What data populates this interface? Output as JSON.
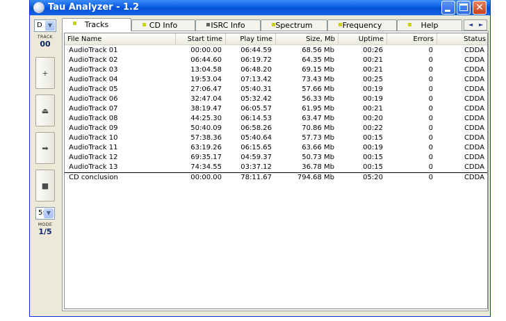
{
  "window": {
    "title": "Tau Analyzer - 1.2",
    "close_glyph": "✕"
  },
  "left_panel": {
    "drive_value": "D",
    "track_label": "TRACK",
    "track_number": "00",
    "buttons": [
      {
        "name": "add-button",
        "glyph": "+",
        "icon": "plus-icon"
      },
      {
        "name": "eject-button",
        "glyph": "⏏",
        "icon": "eject-icon"
      },
      {
        "name": "play-button",
        "glyph": "➡",
        "icon": "play-icon"
      },
      {
        "name": "stop-button",
        "glyph": "■",
        "icon": "stop-icon"
      }
    ],
    "speed_value": "5:",
    "mode_label": "MODE",
    "mode_value": "1/5"
  },
  "tabs": [
    {
      "label": "Tracks",
      "active": true,
      "led_color": "#c8d400"
    },
    {
      "label": "CD Info",
      "active": false,
      "led_color": "#c8d400"
    },
    {
      "label": "ISRC Info",
      "active": false,
      "led_color": "#606060"
    },
    {
      "label": "Spectrum",
      "active": false,
      "led_color": "#c8d400"
    },
    {
      "label": "Frequency",
      "active": false,
      "led_color": "#c8d400"
    },
    {
      "label": "Help",
      "active": false,
      "led_color": "#c8d400"
    }
  ],
  "tab_scroll": {
    "left": "◄",
    "right": "►"
  },
  "table": {
    "columns": [
      "File Name",
      "Start time",
      "Play time",
      "Size, Mb",
      "Uptime",
      "Errors",
      "Status"
    ],
    "rows": [
      [
        "AudioTrack 01",
        "00:00.00",
        "06:44.59",
        "68.56 Mb",
        "00:26",
        "0",
        "CDDA"
      ],
      [
        "AudioTrack 02",
        "06:44.60",
        "06:19.72",
        "64.35 Mb",
        "00:21",
        "0",
        "CDDA"
      ],
      [
        "AudioTrack 03",
        "13:04.58",
        "06:48.20",
        "69.15 Mb",
        "00:21",
        "0",
        "CDDA"
      ],
      [
        "AudioTrack 04",
        "19:53.04",
        "07:13.42",
        "73.43 Mb",
        "00:25",
        "0",
        "CDDA"
      ],
      [
        "AudioTrack 05",
        "27:06.47",
        "05:40.31",
        "57.66 Mb",
        "00:19",
        "0",
        "CDDA"
      ],
      [
        "AudioTrack 06",
        "32:47.04",
        "05:32.42",
        "56.33 Mb",
        "00:19",
        "0",
        "CDDA"
      ],
      [
        "AudioTrack 07",
        "38:19.47",
        "06:05.57",
        "61.95 Mb",
        "00:21",
        "0",
        "CDDA"
      ],
      [
        "AudioTrack 08",
        "44:25.30",
        "06:14.53",
        "63.47 Mb",
        "00:20",
        "0",
        "CDDA"
      ],
      [
        "AudioTrack 09",
        "50:40.09",
        "06:58.26",
        "70.86 Mb",
        "00:22",
        "0",
        "CDDA"
      ],
      [
        "AudioTrack 10",
        "57:38.36",
        "05:40.64",
        "57.73 Mb",
        "00:15",
        "0",
        "CDDA"
      ],
      [
        "AudioTrack 11",
        "63:19.26",
        "06:15.65",
        "63.66 Mb",
        "00:19",
        "0",
        "CDDA"
      ],
      [
        "AudioTrack 12",
        "69:35.17",
        "04:59.37",
        "50.73 Mb",
        "00:15",
        "0",
        "CDDA"
      ],
      [
        "AudioTrack 13",
        "74:34.55",
        "03:37.12",
        "36.78 Mb",
        "00:15",
        "0",
        "CDDA"
      ]
    ],
    "summary": [
      "CD conclusion",
      "00:00.00",
      "78:11.67",
      "794.68 Mb",
      "05:20",
      "0",
      "CDDA"
    ]
  }
}
